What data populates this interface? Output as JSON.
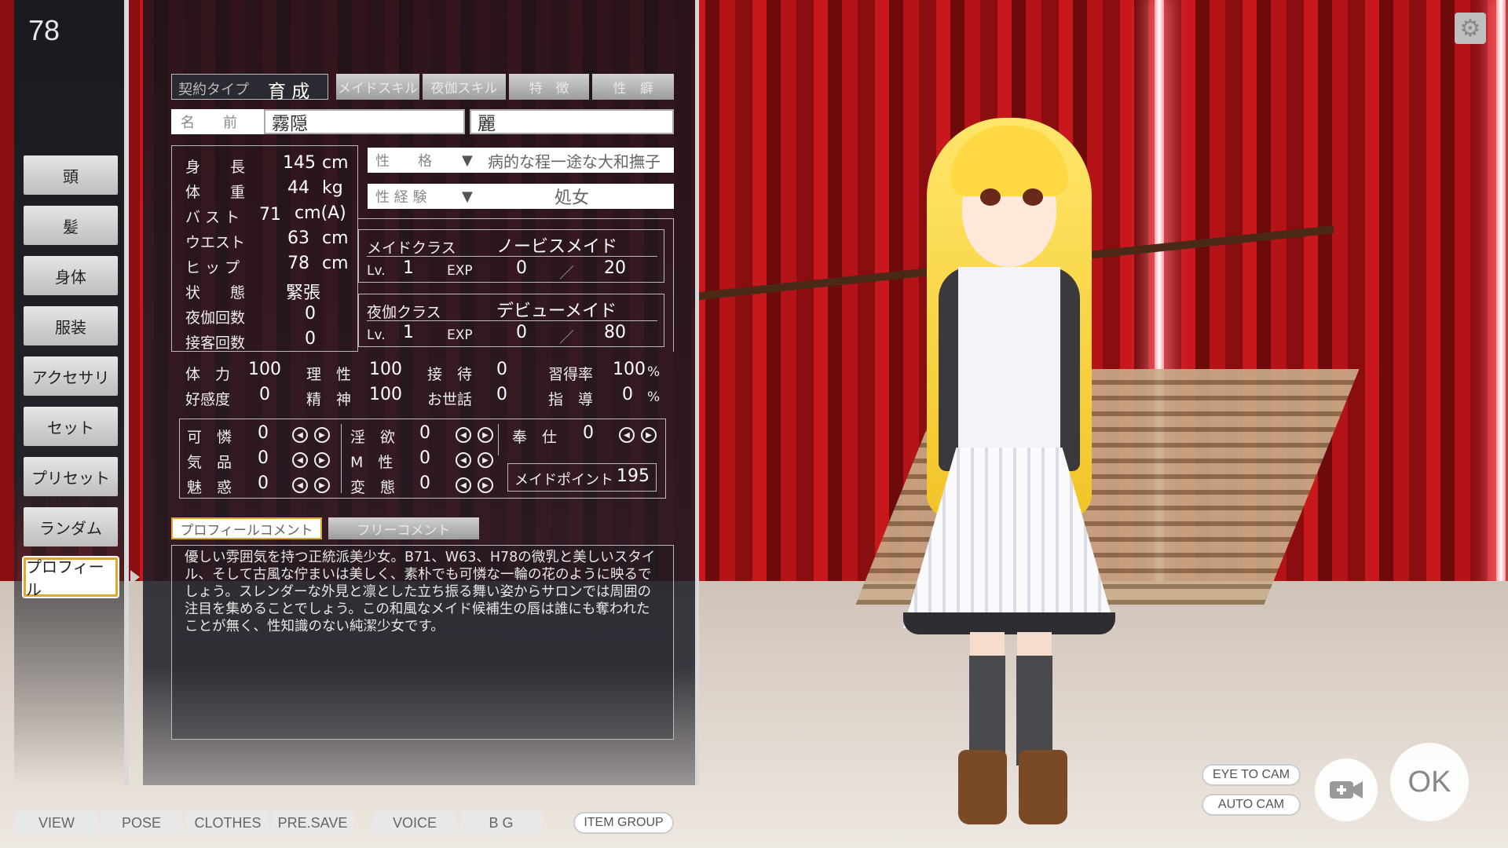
{
  "top_number": "78",
  "nav": [
    "頭",
    "髪",
    "身体",
    "服装",
    "アクセサリ",
    "セット",
    "プリセット",
    "ランダム",
    "プロフィール"
  ],
  "tabs": {
    "contract_label": "契約タイプ",
    "contract_value": "育 成",
    "maid_skill": "メイドスキル",
    "night_skill": "夜伽スキル",
    "traits": "特　徴",
    "fetish": "性　癖"
  },
  "name": {
    "label": "名　　前",
    "last": "霧隠",
    "first": "麗"
  },
  "stats": [
    {
      "label": "身　　長",
      "value": "145",
      "unit": "cm"
    },
    {
      "label": "体　　重",
      "value": "44",
      "unit": "kg"
    },
    {
      "label": "バ ス ト",
      "value": "71",
      "unit": "cm(A)"
    },
    {
      "label": "ウエスト",
      "value": "63",
      "unit": "cm"
    },
    {
      "label": "ヒ ッ プ",
      "value": "78",
      "unit": "cm"
    },
    {
      "label": "状　　態",
      "value": "緊張",
      "unit": ""
    },
    {
      "label": "夜伽回数",
      "value": "0",
      "unit": ""
    },
    {
      "label": "接客回数",
      "value": "0",
      "unit": ""
    }
  ],
  "personality": {
    "label": "性　　格",
    "value": "病的な程一途な大和撫子"
  },
  "experience": {
    "label": "性 経 験",
    "value": "処女"
  },
  "maid_class": {
    "label": "メイドクラス",
    "value": "ノービスメイド",
    "lv_label": "Lv.",
    "lv": "1",
    "exp_label": "EXP",
    "exp": "0",
    "sep": "／",
    "exp_max": "20"
  },
  "night_class": {
    "label": "夜伽クラス",
    "value": "デビューメイド",
    "lv_label": "Lv.",
    "lv": "1",
    "exp_label": "EXP",
    "exp": "0",
    "sep": "／",
    "exp_max": "80"
  },
  "params": [
    {
      "label": "体　力",
      "value": "100"
    },
    {
      "label": "理　性",
      "value": "100"
    },
    {
      "label": "接　待",
      "value": "0"
    },
    {
      "label": "習得率",
      "value": "100",
      "unit": "%"
    },
    {
      "label": "好感度",
      "value": "0"
    },
    {
      "label": "精　神",
      "value": "100"
    },
    {
      "label": "お世話",
      "value": "0"
    },
    {
      "label": "指　導",
      "value": "0",
      "unit": "%"
    }
  ],
  "adjust": [
    {
      "label": "可　憐",
      "value": "0"
    },
    {
      "label": "淫　欲",
      "value": "0"
    },
    {
      "label": "奉　仕",
      "value": "0"
    },
    {
      "label": "気　品",
      "value": "0"
    },
    {
      "label": "M　性",
      "value": "0"
    },
    {
      "label": "魅　惑",
      "value": "0"
    },
    {
      "label": "変　態",
      "value": "0"
    }
  ],
  "maid_point": {
    "label": "メイドポイント",
    "value": "195"
  },
  "comment_tabs": {
    "profile": "プロフィールコメント",
    "free": "フリーコメント"
  },
  "comment": "優しい雰囲気を持つ正統派美少女。B71、W63、H78の微乳と美しいスタイル、そして古風な佇まいは美しく、素朴でも可憐な一輪の花のように映るでしょう。スレンダーな外見と凛とした立ち振る舞い姿からサロンでは周囲の注目を集めることでしょう。この和風なメイド候補生の唇は誰にも奪われたことが無く、性知識のない純潔少女です。",
  "bottom": [
    "VIEW",
    "POSE",
    "CLOTHES",
    "PRE.SAVE",
    "VOICE",
    "B G",
    "ITEM GROUP"
  ],
  "cam": {
    "eye": "EYE TO CAM",
    "auto": "AUTO CAM",
    "ok": "OK"
  }
}
